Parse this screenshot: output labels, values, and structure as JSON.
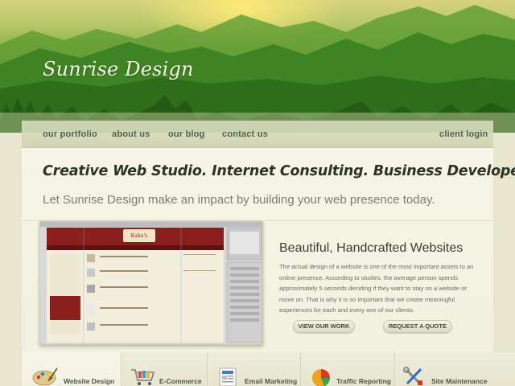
{
  "brand": {
    "name": "Sunrise Design"
  },
  "nav": {
    "items": [
      {
        "label": "our portfolio"
      },
      {
        "label": "about us"
      },
      {
        "label": "our blog"
      },
      {
        "label": "contact us"
      }
    ],
    "client_login": "client login"
  },
  "hero": {
    "headline": "Creative Web Studio. Internet Consulting. Business Developers.",
    "subline": "Let Sunrise Design make an impact by building your web presence today."
  },
  "feature": {
    "title": "Beautiful, Handcrafted Websites",
    "body": "The actual design of a website is one of the most important assets to an online presence. According to studies, the average person spends approximately 5 seconds deciding if they want to stay on a website or move on. That is why it is so important that we create meaningful experiences for each and every one of our clients.",
    "buttons": {
      "view_work": "VIEW OUR WORK",
      "request_quote": "REQUEST A QUOTE"
    },
    "screenshot": {
      "store_name": "Kuhn's"
    }
  },
  "services": [
    {
      "label": "Website Design",
      "icon": "palette-icon",
      "active": true
    },
    {
      "label": "E-Commerce",
      "icon": "shopping-cart-icon",
      "active": false
    },
    {
      "label": "Email Marketing",
      "icon": "newsletter-icon",
      "active": false
    },
    {
      "label": "Traffic Reporting",
      "icon": "pie-chart-icon",
      "active": false
    },
    {
      "label": "Site Maintenance",
      "icon": "tools-icon",
      "active": false
    }
  ],
  "colors": {
    "nav_text": "#55634b",
    "headline": "#2d3327",
    "accent_green": "#3f8a22",
    "screenshot_red": "#8a1f1c"
  }
}
